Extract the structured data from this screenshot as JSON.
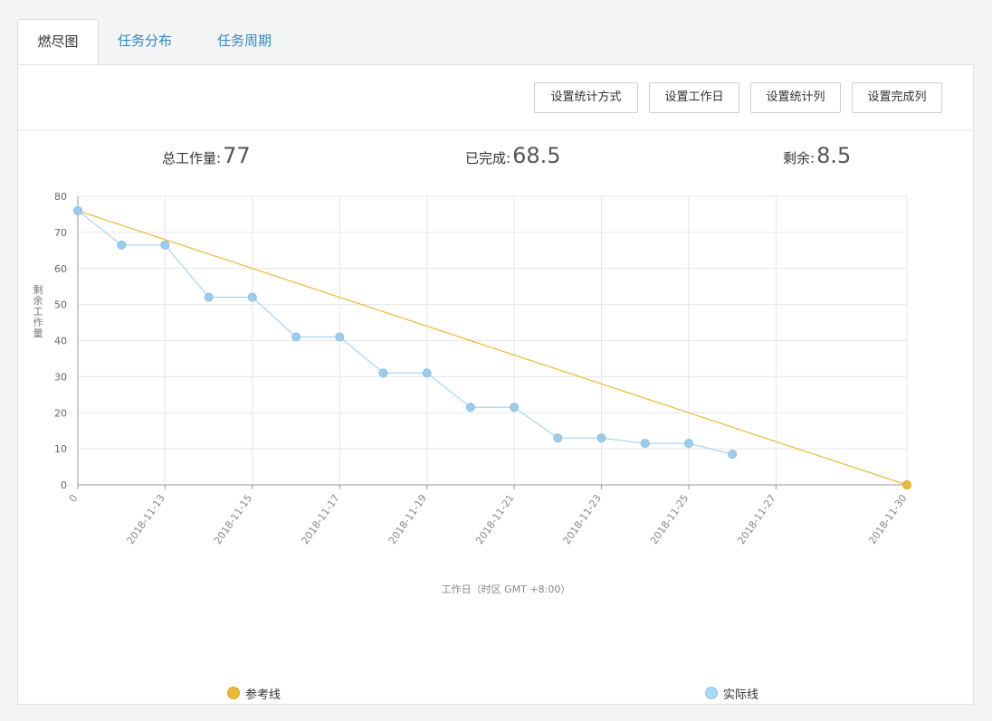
{
  "tabs": [
    {
      "label": "燃尽图",
      "active": true
    },
    {
      "label": "任务分布",
      "active": false
    },
    {
      "label": "任务周期",
      "active": false
    }
  ],
  "toolbar": {
    "buttons": [
      "设置统计方式",
      "设置工作日",
      "设置统计列",
      "设置完成列"
    ]
  },
  "stats": {
    "total_label": "总工作量:",
    "total_value": "77",
    "done_label": "已完成:",
    "done_value": "68.5",
    "remaining_label": "剩余:",
    "remaining_value": "8.5"
  },
  "colors": {
    "tab_link": "#2f8ac4",
    "reference": "#e8b93a",
    "actual": "#a9d4f0",
    "actual_point": "#9ecbeb"
  },
  "chart_data": {
    "type": "line",
    "ylabel": "剩余工作量",
    "xlabel": "工作日（时区 GMT +8:00）",
    "ylim": [
      0,
      80
    ],
    "yticks": [
      0,
      10,
      20,
      30,
      40,
      50,
      60,
      70,
      80
    ],
    "x_ticks": [
      "0",
      "2018-11-13",
      "2018-11-15",
      "2018-11-17",
      "2018-11-19",
      "2018-11-21",
      "2018-11-23",
      "2018-11-25",
      "2018-11-27",
      "2018-11-30"
    ],
    "grid": true,
    "legend_position": "bottom",
    "series": [
      {
        "name": "参考线",
        "x": [
          "0",
          "2018-11-30"
        ],
        "values": [
          76,
          0
        ]
      },
      {
        "name": "实际线",
        "x": [
          "0",
          "2018-11-12",
          "2018-11-13",
          "2018-11-14",
          "2018-11-15",
          "2018-11-16",
          "2018-11-17",
          "2018-11-18",
          "2018-11-19",
          "2018-11-20",
          "2018-11-21",
          "2018-11-22",
          "2018-11-23",
          "2018-11-24",
          "2018-11-25",
          "2018-11-26"
        ],
        "values": [
          76,
          66.5,
          66.5,
          52,
          52,
          41,
          41,
          31,
          31,
          21.5,
          21.5,
          13,
          13,
          11.5,
          11.5,
          8.5
        ]
      }
    ]
  }
}
